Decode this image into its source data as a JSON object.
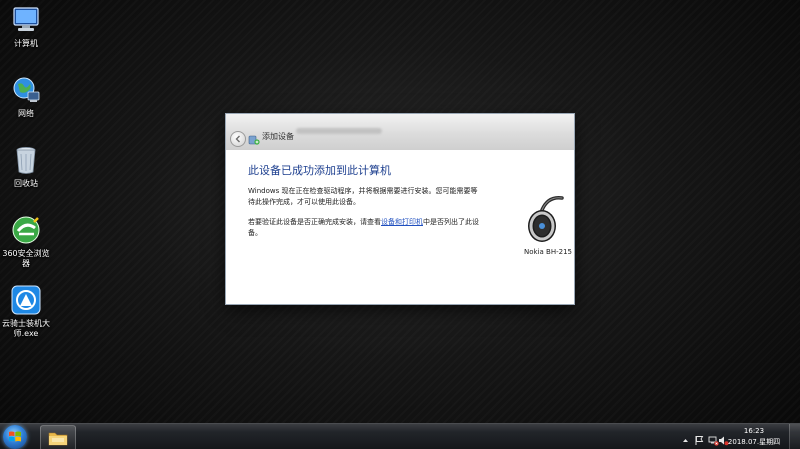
{
  "desktop": {
    "icons": [
      {
        "label": "计算机",
        "icon": "computer-icon"
      },
      {
        "label": "网络",
        "icon": "network-icon"
      },
      {
        "label": "回收站",
        "icon": "recycle-bin-icon"
      },
      {
        "label": "360安全浏览器",
        "icon": "360-browser-icon"
      },
      {
        "label": "云骑士装机大师.exe",
        "icon": "yunqishi-installer-icon"
      }
    ]
  },
  "dialog": {
    "title": "添加设备",
    "heading": "此设备已成功添加到此计算机",
    "paragraph1": "Windows 现在正在检查驱动程序，并将根据需要进行安装。您可能需要等待此操作完成，才可以使用此设备。",
    "paragraph2_prefix": "若要验证此设备是否正确完成安装，请查看",
    "paragraph2_link": "设备和打印机",
    "paragraph2_suffix": "中是否列出了此设备。",
    "device_name": "Nokia BH-215",
    "device_icon": "bluetooth-headset-icon"
  },
  "taskbar": {
    "start_icon": "windows-start-icon",
    "pinned": [
      {
        "icon": "file-explorer-icon"
      }
    ],
    "tray": [
      "show-hidden-icons",
      "action-center-flag-icon",
      "network-status-icon",
      "volume-muted-icon"
    ],
    "clock": {
      "time": "16:23",
      "date": "2018.07.星期四"
    }
  },
  "colors": {
    "heading_blue": "#1d3f8f",
    "link_blue": "#1f4fbf",
    "start_orb": "#2f7fd6"
  }
}
